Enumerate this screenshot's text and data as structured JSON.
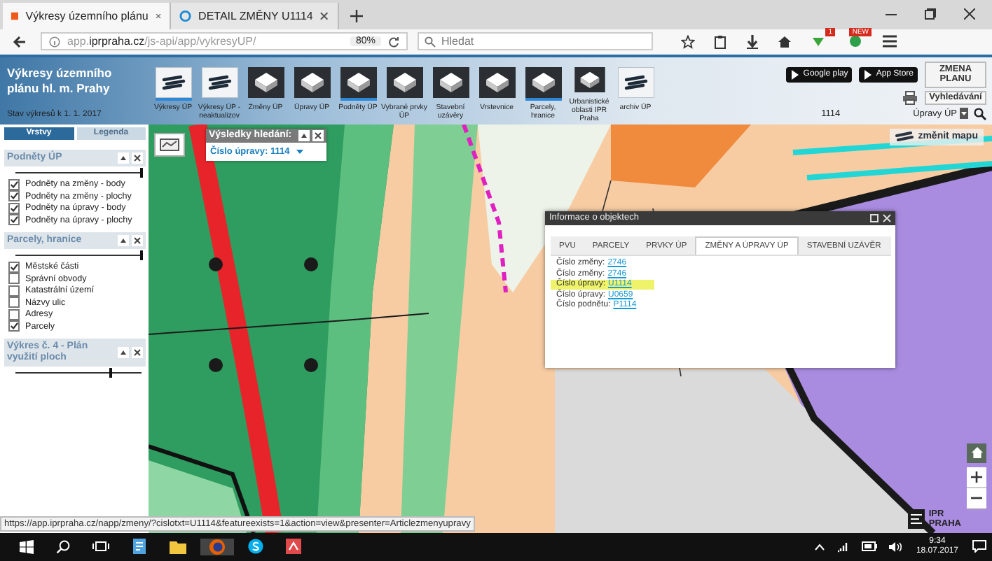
{
  "browser": {
    "tabs": [
      {
        "title": "Výkresy územního plánu",
        "selected": true
      },
      {
        "title": "DETAIL ZMĚNY U1114",
        "selected": false
      }
    ],
    "address": "app.**iprpraha.cz**/js-api/app/vykresyUP/",
    "zoom": "80%",
    "search_placeholder": "Hledat",
    "badges": [
      "1",
      "NEW"
    ]
  },
  "header": {
    "title": "Výkresy územního plánu hl. m. Prahy",
    "subtitle": "Stav výkresů k 1. 1. 2017",
    "tools": [
      {
        "label": "Výkresy ÚP",
        "kind": "stack",
        "selected": true
      },
      {
        "label": "Výkresy ÚP - neaktualizov",
        "kind": "stack",
        "selected": false
      },
      {
        "label": "Změny ÚP",
        "kind": "cube",
        "selected": false
      },
      {
        "label": "Úpravy ÚP",
        "kind": "cube",
        "selected": false
      },
      {
        "label": "Podněty ÚP",
        "kind": "cube",
        "selected": true
      },
      {
        "label": "Vybrané prvky ÚP",
        "kind": "cube",
        "selected": false
      },
      {
        "label": "Stavební uzávěry",
        "kind": "cube",
        "selected": false
      },
      {
        "label": "Vrstevnice",
        "kind": "cube",
        "selected": false
      },
      {
        "label": "Parcely, hranice",
        "kind": "cube",
        "selected": true
      },
      {
        "label": "Urbanistické oblasti IPR Praha",
        "kind": "cube",
        "selected": false
      },
      {
        "label": "archiv ÚP",
        "kind": "stack",
        "selected": false
      }
    ],
    "store_badges": [
      "Google play",
      "App Store"
    ],
    "change_button": "ZMENA PLANU",
    "search_button": "Vyhledávání",
    "search_value": "1114",
    "search_layer": "Úpravy ÚP"
  },
  "left_panel": {
    "tabs": [
      {
        "label": "Vrstvy",
        "selected": true
      },
      {
        "label": "Legenda",
        "selected": false
      }
    ],
    "sections": [
      {
        "title": "Podněty ÚP",
        "level": 1,
        "items": [
          {
            "label": "Podněty na změny - body",
            "checked": true
          },
          {
            "label": "Podněty na změny - plochy",
            "checked": true
          },
          {
            "label": "Podněty na úpravy - body",
            "checked": true
          },
          {
            "label": "Podněty na úpravy - plochy",
            "checked": true
          }
        ]
      },
      {
        "title": "Parcely, hranice",
        "level": 1,
        "items": [
          {
            "label": "Městské části",
            "checked": true
          },
          {
            "label": "Správní obvody",
            "checked": false
          },
          {
            "label": "Katastrální území",
            "checked": false
          },
          {
            "label": "Názvy ulic",
            "checked": false
          },
          {
            "label": "Adresy",
            "checked": false
          },
          {
            "label": "Parcely",
            "checked": true
          }
        ]
      },
      {
        "title": "Výkres č. 4 - Plán využití ploch",
        "level": 0.75
      }
    ]
  },
  "map": {
    "results_popup": {
      "title": "Výsledky hledání:",
      "result": "Číslo úpravy: 1114"
    },
    "info_window": {
      "title": "Informace o objektech",
      "tabs": [
        {
          "label": "PVU",
          "selected": false
        },
        {
          "label": "PARCELY",
          "selected": false
        },
        {
          "label": "PRVKY ÚP",
          "selected": false
        },
        {
          "label": "ZMĚNY A ÚPRAVY ÚP",
          "selected": true
        },
        {
          "label": "STAVEBNÍ UZÁVĚR",
          "selected": false
        }
      ],
      "rows": [
        {
          "label": "Číslo změny:",
          "value": "2746",
          "highlighted": false
        },
        {
          "label": "Číslo změny:",
          "value": "2746",
          "highlighted": false
        },
        {
          "label": "Číslo úpravy:",
          "value": "U1114",
          "highlighted": true
        },
        {
          "label": "Číslo úpravy:",
          "value": "U0659",
          "highlighted": false
        },
        {
          "label": "Číslo podnětu:",
          "value": "P1114",
          "highlighted": false
        }
      ]
    },
    "basemap_button": "změnit mapu",
    "logo_lines": [
      "IPR",
      "PRAHA"
    ]
  },
  "status_url": "https://app.iprpraha.cz/napp/zmeny/?cislotxt=U1114&featureexists=1&action=view&presenter=Articlezmenyupravy",
  "taskbar": {
    "time": "9:34",
    "date": "18.07.2017"
  }
}
